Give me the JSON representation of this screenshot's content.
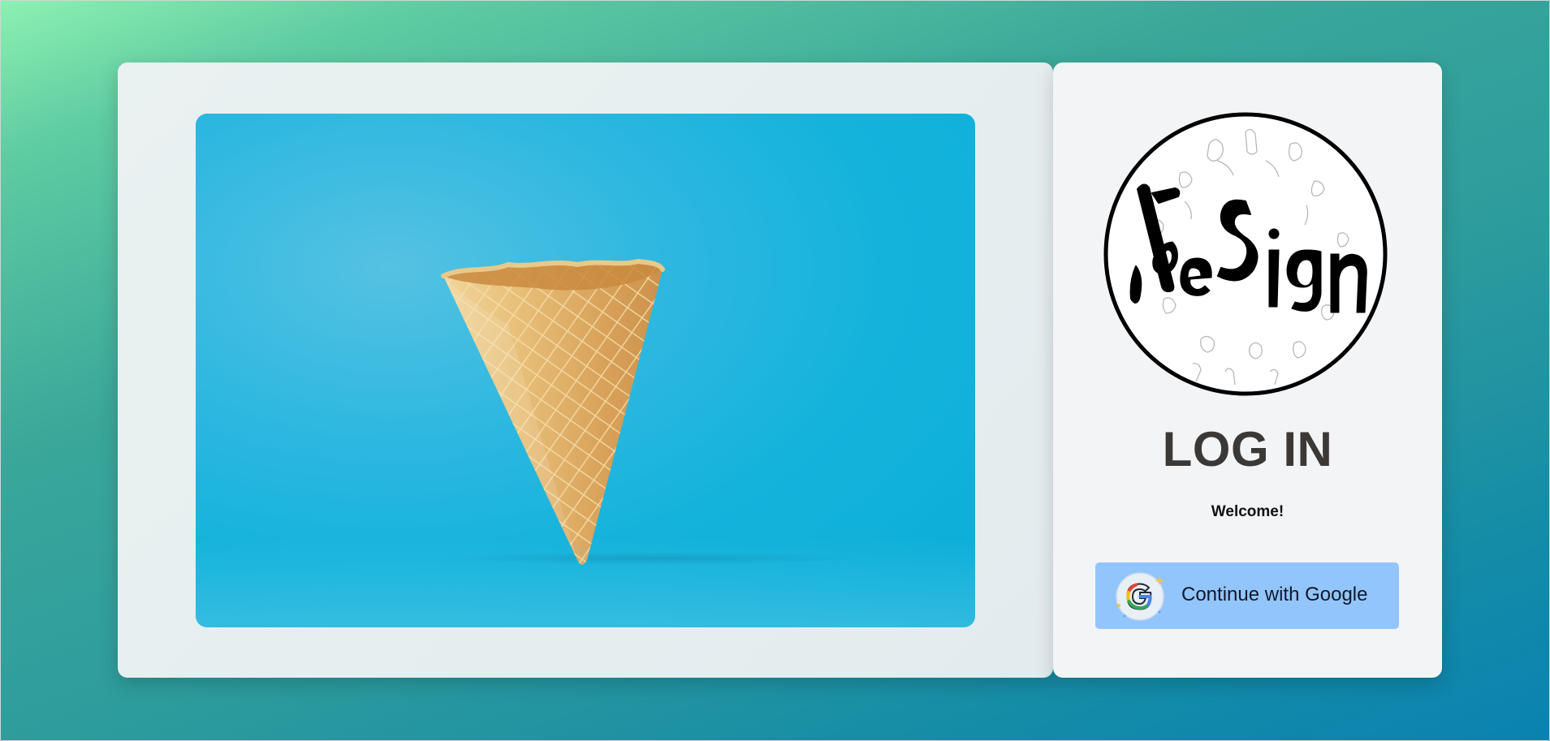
{
  "hero": {
    "image_alt": "empty waffle ice cream cone on blue background"
  },
  "brand": {
    "logo_text": "eSign"
  },
  "login": {
    "title": "LOG IN",
    "welcome": "Welcome!",
    "google_button_label": "Continue with Google",
    "google_icon": "google-g-icon"
  },
  "colors": {
    "google_button_bg": "#93c5fd",
    "title_color": "#3b3835",
    "photo_bg": "#14b3dc"
  }
}
